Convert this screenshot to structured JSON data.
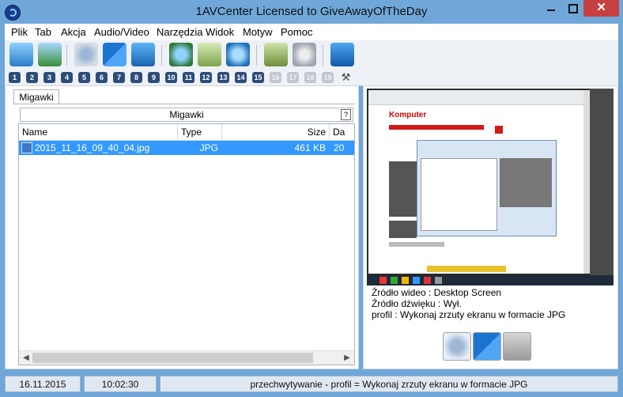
{
  "window": {
    "title": "1AVCenter Licensed to GiveAwayOfTheDay",
    "close_glyph": "✕"
  },
  "menu": [
    "Plik",
    "Tab",
    "Akcja",
    "Audio/Video",
    "Narzędzia",
    "Widok",
    "Motyw",
    "Pomoc"
  ],
  "toolbar_icons": [
    "screen-record-icon",
    "capture-icon",
    "webcam-icon",
    "dual-monitor-icon",
    "screen-icon",
    "globe-web-icon",
    "email-icon",
    "upload-globe-icon",
    "book-icon",
    "settings-gears-icon",
    "help-icon"
  ],
  "profiles": [
    "1",
    "2",
    "3",
    "4",
    "5",
    "6",
    "7",
    "8",
    "9",
    "10",
    "11",
    "12",
    "13",
    "14",
    "15",
    "16",
    "17",
    "18",
    "19"
  ],
  "profiles_active_count": 15,
  "left_panel": {
    "tab_label": "Migawki",
    "header": "Migawki",
    "help": "?",
    "columns": [
      "Name",
      "Type",
      "Size",
      "Da"
    ],
    "rows": [
      {
        "name": "2015_11_16_09_40_04.jpg",
        "type": "JPG",
        "size": "461 KB",
        "date": "20"
      }
    ],
    "scroll_left": "◀",
    "scroll_right": "▶"
  },
  "right_panel": {
    "preview_logo": "Komputer",
    "video_source": "Źródło wideo : Desktop Screen",
    "audio_source": "Źródło dźwięku : Wył.",
    "profile": "profil : Wykonaj zrzuty ekranu w formacie JPG",
    "buttons": [
      "webcam-snapshot-icon",
      "dual-monitor-icon",
      "lock-icon"
    ]
  },
  "status": {
    "date": "16.11.2015",
    "time": "10:02:30",
    "message": "przechwytywanie - profil = Wykonaj zrzuty ekranu w formacie JPG"
  },
  "colors": {
    "frame": "#6fa7d9",
    "selection": "#3399ff",
    "status_box": "#dfe8f2"
  }
}
